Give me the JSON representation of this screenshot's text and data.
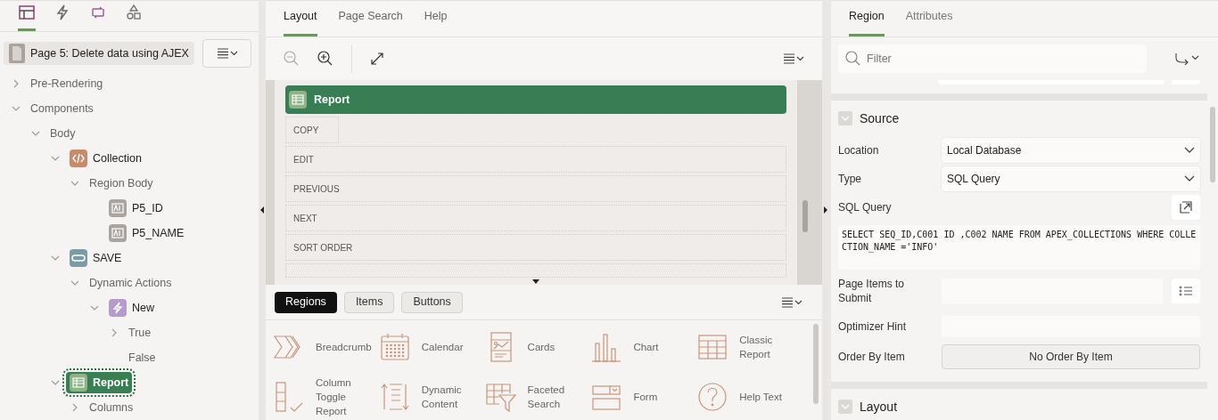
{
  "left_tabs": [
    {
      "kind": "rendering",
      "selected": true
    },
    {
      "kind": "dynamic",
      "selected": false
    },
    {
      "kind": "processing",
      "selected": false
    },
    {
      "kind": "shared",
      "selected": false
    }
  ],
  "page_title": "Page 5: Delete data using AJEX",
  "tree": [
    {
      "label": "Pre-Rendering",
      "expanded": false,
      "selected": false
    },
    {
      "label": "Components",
      "expanded": true,
      "selected": false,
      "children": [
        {
          "label": "Body",
          "expanded": true,
          "selected": false,
          "children": [
            {
              "label": "Collection",
              "kind": "code",
              "expanded": true,
              "selected": false,
              "children": [
                {
                  "label": "Region Body",
                  "expanded": true,
                  "selected": false,
                  "children": [
                    {
                      "label": "P5_ID",
                      "kind": "item",
                      "selected": false
                    },
                    {
                      "label": "P5_NAME",
                      "kind": "item",
                      "selected": false
                    }
                  ]
                }
              ]
            },
            {
              "label": "SAVE",
              "kind": "button",
              "expanded": true,
              "selected": false,
              "children": [
                {
                  "label": "Dynamic Actions",
                  "expanded": true,
                  "selected": false,
                  "children": [
                    {
                      "label": "New",
                      "kind": "action",
                      "expanded": true,
                      "selected": false,
                      "children": [
                        {
                          "label": "True",
                          "expanded": false,
                          "selected": false
                        },
                        {
                          "label": "False",
                          "selected": false
                        }
                      ]
                    }
                  ]
                }
              ]
            },
            {
              "label": "Report",
              "kind": "report",
              "expanded": true,
              "selected": true,
              "children": [
                {
                  "label": "Columns",
                  "expanded": false,
                  "selected": false
                }
              ]
            }
          ]
        }
      ]
    }
  ],
  "center_tabs": [
    {
      "label": "Layout",
      "selected": true
    },
    {
      "label": "Page Search",
      "selected": false
    },
    {
      "label": "Help",
      "selected": false
    }
  ],
  "canvas": {
    "region_title": "Report",
    "buttons": [
      {
        "label": "COPY",
        "kind": "short"
      },
      {
        "label": "EDIT",
        "kind": "wide"
      },
      {
        "label": "PREVIOUS",
        "kind": "wide"
      },
      {
        "label": "NEXT",
        "kind": "wide"
      },
      {
        "label": "SORT ORDER",
        "kind": "wide"
      },
      {
        "kind": "wide"
      }
    ]
  },
  "gallery_tabs": [
    {
      "label": "Regions",
      "selected": true
    },
    {
      "label": "Items",
      "selected": false
    },
    {
      "label": "Buttons",
      "selected": false
    }
  ],
  "gallery": [
    {
      "label": "Breadcrumb",
      "kind": "breadcrumb"
    },
    {
      "label": "Calendar",
      "kind": "calendar"
    },
    {
      "label": "Cards",
      "kind": "cards"
    },
    {
      "label": "Chart",
      "kind": "chart"
    },
    {
      "label": "Classic Report",
      "kind": "table"
    },
    {
      "label": "Column Toggle Report",
      "kind": "toggle"
    },
    {
      "label": "Dynamic Content",
      "kind": "dynamic"
    },
    {
      "label": "Faceted Search",
      "kind": "faceted"
    },
    {
      "label": "Form",
      "kind": "form"
    },
    {
      "label": "Help Text",
      "kind": "help"
    }
  ],
  "right_tabs": [
    {
      "label": "Region",
      "selected": true
    },
    {
      "label": "Attributes",
      "selected": false
    }
  ],
  "filter": {
    "placeholder": "Filter"
  },
  "sections": [
    {
      "title": "Source",
      "expanded": true,
      "fields": [
        {
          "label": "Location",
          "kind": "select",
          "value": "Local Database"
        },
        {
          "label": "Type",
          "kind": "select",
          "value": "SQL Query"
        },
        {
          "label": "SQL Query",
          "kind": "code",
          "value": "SELECT SEQ_ID,C001 ID ,C002 NAME FROM APEX_COLLECTIONS WHERE COLLECTION_NAME ='INFO'"
        },
        {
          "label": "Page Items to Submit",
          "kind": "picker"
        },
        {
          "label": "Optimizer Hint",
          "kind": "text"
        },
        {
          "label": "Order By Item",
          "kind": "button",
          "value": "No Order By Item"
        }
      ]
    },
    {
      "title": "Layout",
      "expanded": true
    }
  ]
}
